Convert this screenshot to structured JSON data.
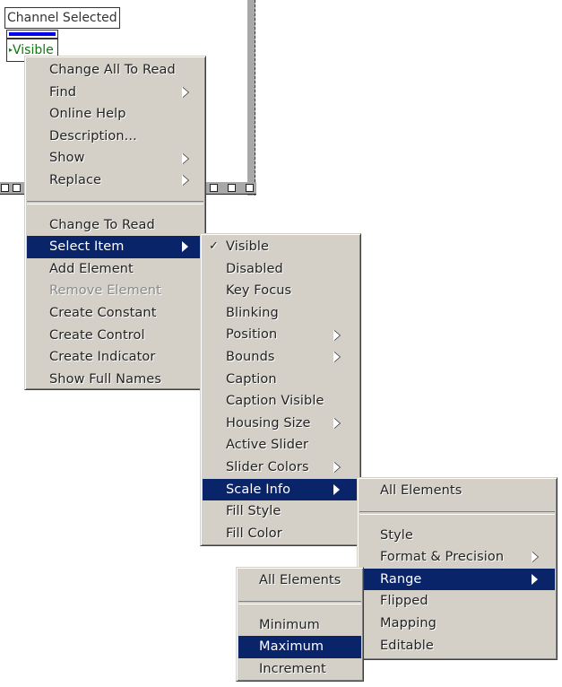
{
  "panel": {
    "channel_label": "Channel Selected",
    "ring_value": "Visible",
    "slider_color": "#0000ee",
    "ring_text_color": "#117711"
  },
  "menus": {
    "main": {
      "items": [
        {
          "label": "Change All To Read",
          "submenu": false,
          "state": "normal"
        },
        {
          "label": "Find",
          "submenu": true,
          "state": "normal"
        },
        {
          "label": "Online Help",
          "submenu": false,
          "state": "normal"
        },
        {
          "label": "Description...",
          "submenu": false,
          "state": "normal"
        },
        {
          "label": "Show",
          "submenu": true,
          "state": "normal"
        },
        {
          "label": "Replace",
          "submenu": true,
          "state": "normal"
        },
        {
          "separator": true
        },
        {
          "label": "Change To Read",
          "submenu": false,
          "state": "normal"
        },
        {
          "label": "Select Item",
          "submenu": true,
          "state": "highlighted"
        },
        {
          "label": "Add Element",
          "submenu": false,
          "state": "normal"
        },
        {
          "label": "Remove Element",
          "submenu": false,
          "state": "disabled"
        },
        {
          "label": "Create Constant",
          "submenu": false,
          "state": "normal"
        },
        {
          "label": "Create Control",
          "submenu": false,
          "state": "normal"
        },
        {
          "label": "Create Indicator",
          "submenu": false,
          "state": "normal"
        },
        {
          "label": "Show Full Names",
          "submenu": false,
          "state": "normal"
        }
      ]
    },
    "select_item": {
      "items": [
        {
          "label": "Visible",
          "submenu": false,
          "state": "normal",
          "checked": true
        },
        {
          "label": "Disabled",
          "submenu": false,
          "state": "normal"
        },
        {
          "label": "Key Focus",
          "submenu": false,
          "state": "normal"
        },
        {
          "label": "Blinking",
          "submenu": false,
          "state": "normal"
        },
        {
          "label": "Position",
          "submenu": true,
          "state": "normal"
        },
        {
          "label": "Bounds",
          "submenu": true,
          "state": "normal"
        },
        {
          "label": "Caption",
          "submenu": false,
          "state": "normal"
        },
        {
          "label": "Caption Visible",
          "submenu": false,
          "state": "normal"
        },
        {
          "label": "Housing Size",
          "submenu": true,
          "state": "normal"
        },
        {
          "label": "Active Slider",
          "submenu": false,
          "state": "normal"
        },
        {
          "label": "Slider Colors",
          "submenu": true,
          "state": "normal"
        },
        {
          "label": "Scale Info",
          "submenu": true,
          "state": "highlighted"
        },
        {
          "label": "Fill Style",
          "submenu": false,
          "state": "normal"
        },
        {
          "label": "Fill Color",
          "submenu": false,
          "state": "normal"
        }
      ]
    },
    "scale_info": {
      "items": [
        {
          "label": "All Elements",
          "submenu": false,
          "state": "normal"
        },
        {
          "separator": true
        },
        {
          "label": "Style",
          "submenu": false,
          "state": "normal"
        },
        {
          "label": "Format & Precision",
          "submenu": true,
          "state": "normal"
        },
        {
          "label": "Range",
          "submenu": true,
          "state": "highlighted"
        },
        {
          "label": "Flipped",
          "submenu": false,
          "state": "normal"
        },
        {
          "label": "Mapping",
          "submenu": false,
          "state": "normal"
        },
        {
          "label": "Editable",
          "submenu": false,
          "state": "normal"
        }
      ]
    },
    "range": {
      "items": [
        {
          "label": "All Elements",
          "submenu": false,
          "state": "normal"
        },
        {
          "separator": true
        },
        {
          "label": "Minimum",
          "submenu": false,
          "state": "normal"
        },
        {
          "label": "Maximum",
          "submenu": false,
          "state": "highlighted"
        },
        {
          "label": "Increment",
          "submenu": false,
          "state": "normal"
        }
      ]
    },
    "highlight_color": "#0a246a",
    "menu_bg": "#d4d0c8"
  }
}
